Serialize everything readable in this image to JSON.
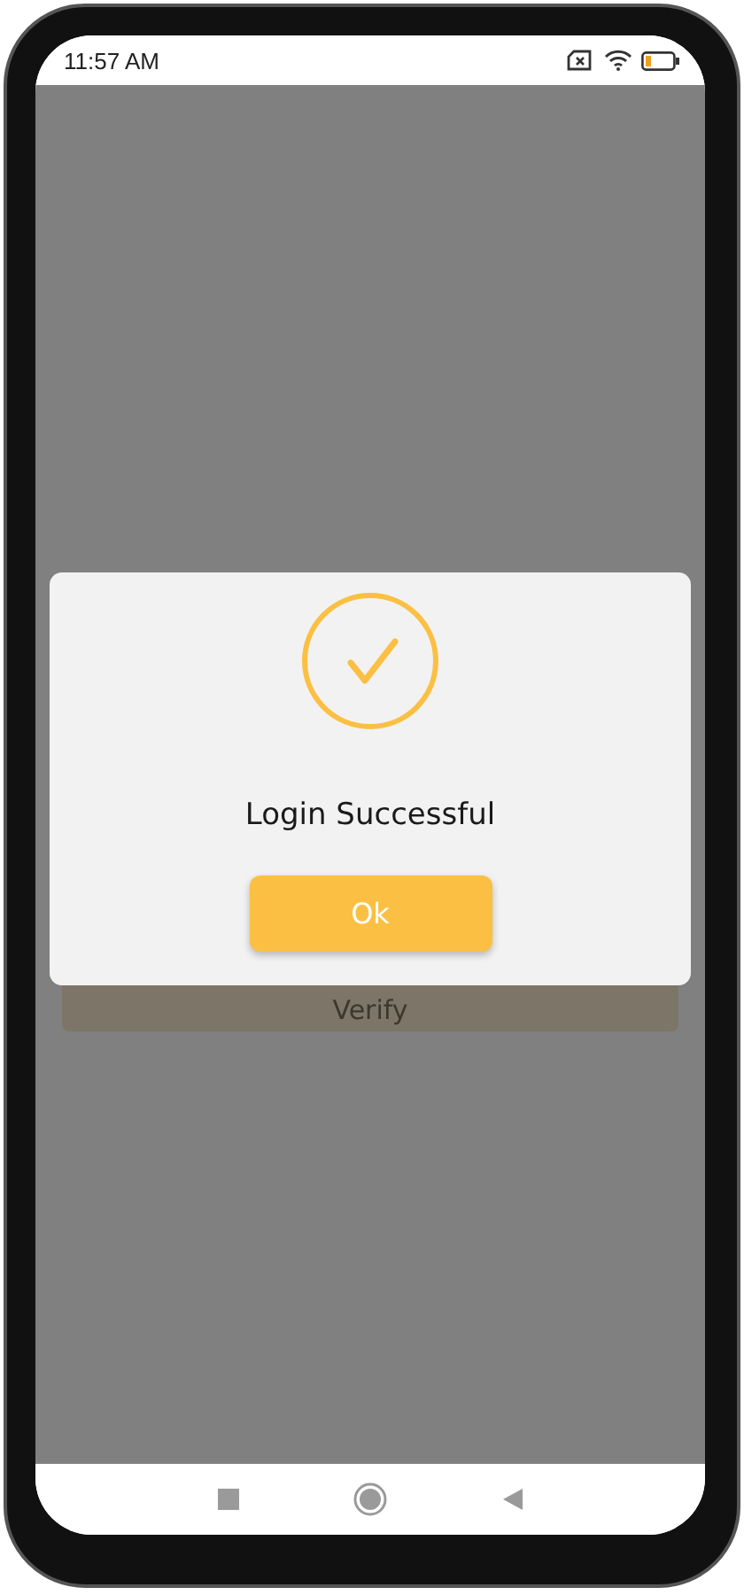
{
  "status_bar": {
    "time": "11:57 AM"
  },
  "background": {
    "button": "Verify"
  },
  "dialog": {
    "message": "Login Successful",
    "button": "Ok"
  }
}
